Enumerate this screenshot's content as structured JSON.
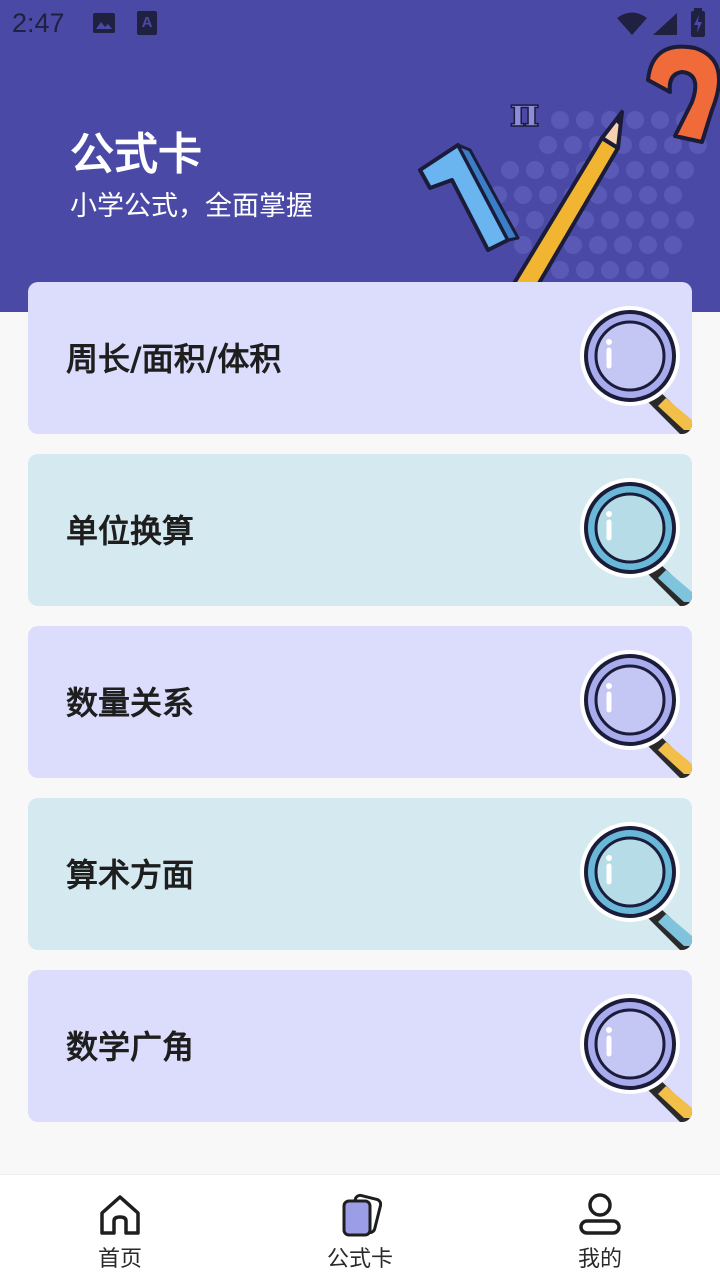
{
  "status_bar": {
    "time": "2:47",
    "icons": [
      "image-icon",
      "text-a-icon",
      "wifi-icon",
      "signal-icon",
      "battery-charging-icon"
    ]
  },
  "header": {
    "title": "公式卡",
    "subtitle": "小学公式，全面掌握",
    "decoration": [
      "number-1",
      "pi-symbol",
      "pencil",
      "number-2"
    ]
  },
  "cards": [
    {
      "label": "周长/面积/体积",
      "color": "#dcdcfc",
      "icon": "magnifier-icon"
    },
    {
      "label": "单位换算",
      "color": "#d5e9f0",
      "icon": "magnifier-icon"
    },
    {
      "label": "数量关系",
      "color": "#dcdcfc",
      "icon": "magnifier-icon"
    },
    {
      "label": "算术方面",
      "color": "#d5e9f0",
      "icon": "magnifier-icon"
    },
    {
      "label": "数学广角",
      "color": "#dcdcfc",
      "icon": "magnifier-icon"
    }
  ],
  "bottom_nav": [
    {
      "label": "首页",
      "icon": "home-icon",
      "active": false
    },
    {
      "label": "公式卡",
      "icon": "cards-icon",
      "active": true
    },
    {
      "label": "我的",
      "icon": "profile-icon",
      "active": false
    }
  ],
  "colors": {
    "header_bg": "#4a4aa6",
    "card_purple": "#dcdcfc",
    "card_blue": "#d5e9f0",
    "accent": "#9b9ee6"
  }
}
